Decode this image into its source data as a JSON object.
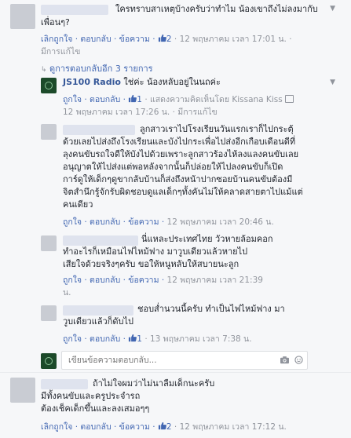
{
  "c1": {
    "text_l1": "ใครทราบสาเหตุบ้างครับว่าทำไม น้องเขาถึงไม่ลงมากับ",
    "text_l2": "เพื่อนๆ?",
    "actions": "เลิกถูกใจ · ตอบกลับ · ข้อความ ·",
    "likes": "2",
    "time": "· 12 พฤษภาคม เวลา 17:01 น. ·",
    "edited": "มีการแก้ไข"
  },
  "replies_link": "ดูการตอบกลับอีก 3 รายการ",
  "r1": {
    "author": "JS100 Radio",
    "text": "ใช่ค่ะ น้องหลับอยู่ในนถค่ะ",
    "actions": "ถูกใจ · ตอบกลับ ·",
    "likes": "1",
    "meta": "· แสดงความคิดเห็นโดย Kissana Kiss",
    "time": "12 พฤษภาคม เวลา 17:26 น. · มีการแก้ไข"
  },
  "r2": {
    "lines": [
      "ลูกสาวเราไปโรงเรียนวันแรกเราก็ไปกระตุ้",
      "ด้วยเลยไปส่งถึงโรงเรียนและบังไปกระเพื่อไปส่งอีกเกือบเดือนดีที่",
      "ลุงคนขับรถใจดีให้บังไปด้วยเพราะลูกสาวร้องไห้ลงแลงคนขับเลย",
      "อนุญาตให้ไปส่งแต่พอหลังจากนั้นก็ปล่อยให้ไปลงคนขับก็เปิด",
      "การ์ดูให้เด็กๆดูขากลับบ้านก็ส่งถึงหน้าปากซอยบ้านคนขับต้องมี",
      "จิตสำนึกรู้จักรับผิดชอบดูแลเด็กๆทั้งคันไม่ให้คลาดสายตาไปแม้แต่",
      "คนเดียว"
    ],
    "actions": "ถูกใจ · ตอบกลับ · ข้อความ ·",
    "time": "12 พฤษภาคม เวลา 20:46 น."
  },
  "r3": {
    "lines": [
      "นี่แหละประเทศไทย วัวหายล้อมคอก",
      "ทำอะไรก็เหมือนไฟไหม้ฟาง มาวูบเดียวแล้วหายไป",
      "เสียใจด้วยจริงๆครับ ขอให้หนูหลับให้สบายนะลูก"
    ],
    "actions": "ถูกใจ · ตอบกลับ · ข้อความ ·",
    "time": "12 พฤษภาคม เวลา 21:39",
    "time_suffix": "น."
  },
  "r4": {
    "lines": [
      "ชอบส่ำนวนนี้ครับ ทำเป็นไฟไหม้ฟาง มา",
      "วูบเดียวแล้วก็ดับไป"
    ],
    "actions": "ถูกใจ · ตอบกลับ ·",
    "likes": "1",
    "time": "· 13 พฤษภาคม เวลา 7:38 น."
  },
  "reply_input": {
    "placeholder": "เขียนข้อความตอบกลับ..."
  },
  "c2": {
    "lines": [
      "ถ้าไม่ใจผมว่าไม่นาลืมเด็กนะครับ",
      "มีทั้งคนขับและครูประจำรถ",
      "ต้องเช็คเด็กขึ้นและลงเสมอๆๆ"
    ],
    "actions": "เลิกถูกใจ · ตอบกลับ · ข้อความ ·",
    "likes": "2",
    "time": "· 12 พฤษภาคม เวลา 17:12 น."
  }
}
